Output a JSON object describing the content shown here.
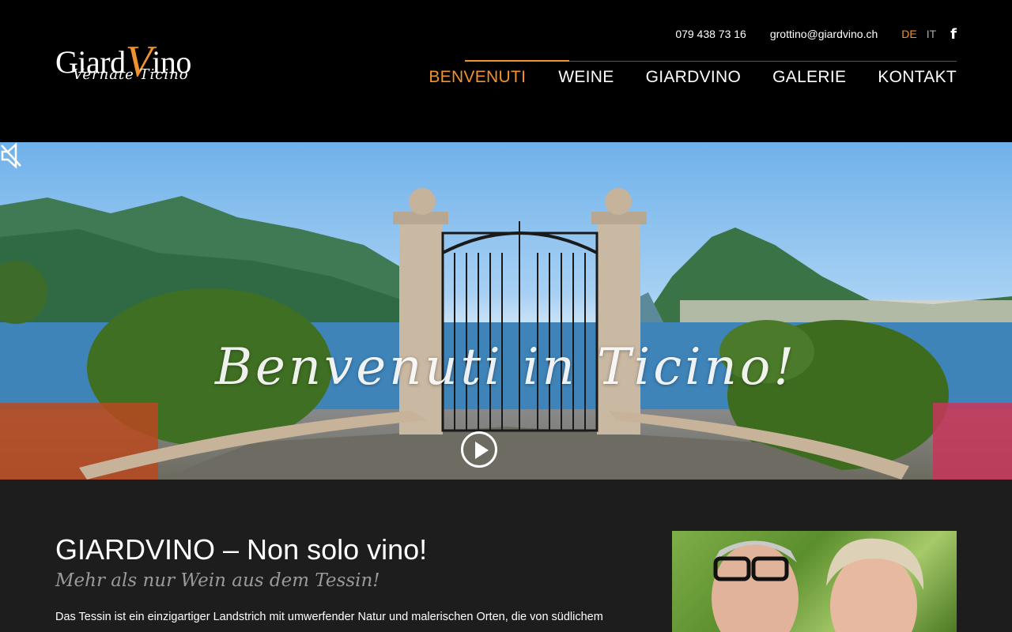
{
  "header": {
    "logo": {
      "main_prefix": "Giard",
      "main_v": "V",
      "main_suffix": "ino",
      "subtitle": "Vernate Ticino"
    },
    "phone": "079 438 73 16",
    "email": "grottino@giardvino.ch",
    "languages": [
      {
        "label": "DE",
        "active": true
      },
      {
        "label": "IT",
        "active": false
      }
    ],
    "social_icon": "facebook-icon",
    "facebook_glyph": "f",
    "nav": [
      {
        "label": "BENVENUTI",
        "active": true
      },
      {
        "label": "WEINE",
        "active": false
      },
      {
        "label": "GIARDVINO",
        "active": false
      },
      {
        "label": "GALERIE",
        "active": false
      },
      {
        "label": "KONTAKT",
        "active": false
      }
    ]
  },
  "hero": {
    "title": "Benvenuti in Ticino!",
    "play_icon": "play-icon",
    "mute_icon": "mute-icon"
  },
  "content": {
    "heading": "GIARDVINO – Non solo vino!",
    "subheading": "Mehr als nur Wein aus dem Tessin!",
    "paragraph": "Das Tessin ist ein einzigartiger Landstrich mit umwerfender Natur und malerischen Orten, die von südlichem"
  },
  "colors": {
    "accent": "#f0922e",
    "header_bg": "#000000",
    "content_bg": "#1d1d1d",
    "muted_text": "#9a9a9a"
  }
}
